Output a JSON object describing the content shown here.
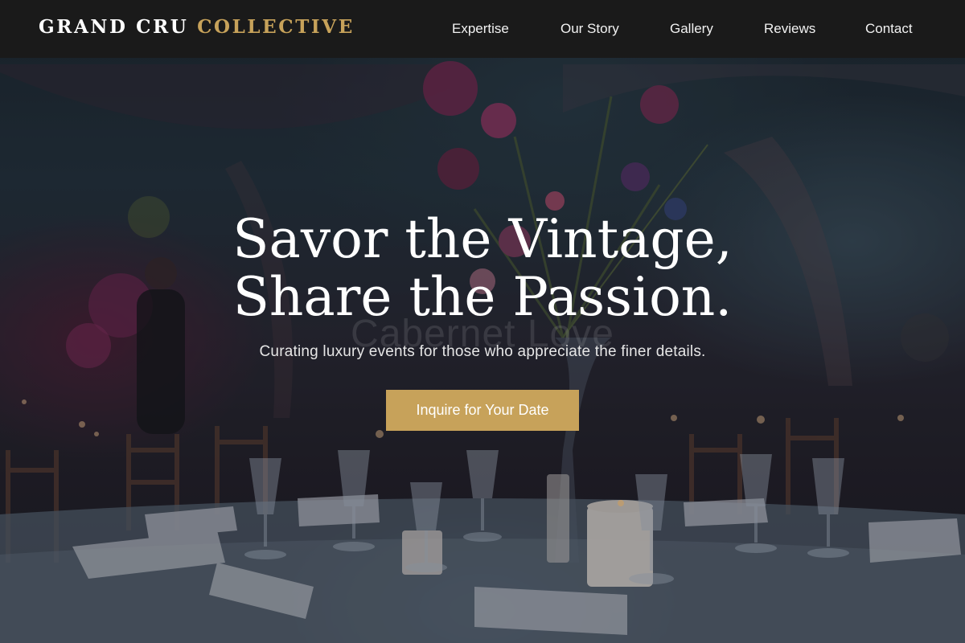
{
  "nav": {
    "brand": {
      "primary": "GRAND CRU",
      "accent": "COLLECTIVE"
    },
    "links": [
      {
        "label": "Expertise"
      },
      {
        "label": "Our Story"
      },
      {
        "label": "Gallery"
      },
      {
        "label": "Reviews"
      },
      {
        "label": "Contact"
      }
    ]
  },
  "hero": {
    "title_line_1": "Savor the Vintage,",
    "title_line_2": "Share the Passion.",
    "background_watermark": "Cabernet Love",
    "subtitle": "Curating luxury events for those who appreciate the finer details.",
    "cta_label": "Inquire for Your Date",
    "background_image": "candlelit tent dinner table with glassware and floral centerpiece"
  },
  "colors": {
    "nav_background": "#1a1a1a",
    "accent_gold": "#c7a25a",
    "text_white": "#ffffff"
  }
}
